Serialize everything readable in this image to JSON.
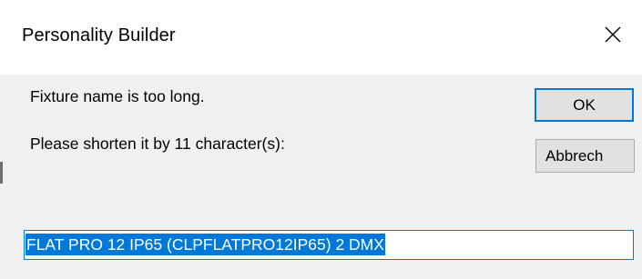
{
  "dialog": {
    "title": "Personality Builder",
    "close_icon": "close-icon",
    "message_line1": "Fixture name is too long.",
    "message_line2": "Please shorten it by 11 character(s):",
    "ok_label": "OK",
    "cancel_label": "Abbrech",
    "name_value": "FLAT PRO 12 IP65 (CLPFLATPRO12IP65) 2 DMX",
    "colors": {
      "accent": "#0078d7",
      "button_face": "#e1e1e1",
      "dialog_bg": "#f0f0f0"
    }
  }
}
